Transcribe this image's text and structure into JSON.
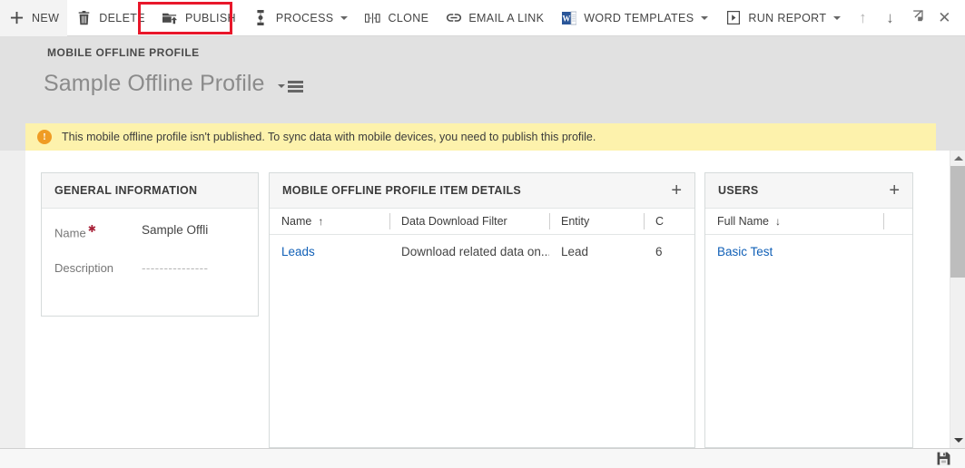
{
  "command_bar": {
    "commands": [
      {
        "id": "new",
        "label": "NEW",
        "icon": "plus-icon",
        "has_caret": false
      },
      {
        "id": "delete",
        "label": "DELETE",
        "icon": "trash-icon",
        "has_caret": false
      },
      {
        "id": "publish",
        "label": "PUBLISH",
        "icon": "publish-icon",
        "has_caret": false,
        "highlighted": true
      },
      {
        "id": "process",
        "label": "PROCESS",
        "icon": "process-icon",
        "has_caret": true
      },
      {
        "id": "clone",
        "label": "CLONE",
        "icon": "clone-icon",
        "has_caret": false
      },
      {
        "id": "email-a-link",
        "label": "EMAIL A LINK",
        "icon": "link-icon",
        "has_caret": false
      },
      {
        "id": "word-templates",
        "label": "WORD TEMPLATES",
        "icon": "word-document-icon",
        "has_caret": true
      },
      {
        "id": "run-report",
        "label": "RUN REPORT",
        "icon": "report-icon",
        "has_caret": true
      }
    ],
    "right_buttons": [
      {
        "id": "previous-record",
        "icon": "arrow-up-icon",
        "glyph": "↑",
        "dim": true
      },
      {
        "id": "next-record",
        "icon": "arrow-down-icon",
        "glyph": "↓",
        "dim": false
      },
      {
        "id": "pop-out",
        "icon": "pop-out-icon",
        "glyph": "",
        "dim": false
      },
      {
        "id": "close",
        "icon": "close-icon",
        "glyph": "✕",
        "dim": false
      }
    ],
    "highlight_color": "#e8172a"
  },
  "header": {
    "breadcrumb": "MOBILE OFFLINE PROFILE",
    "record_title": "Sample Offline Profile",
    "form_selector_icon": "form-selector-icon"
  },
  "notification": {
    "icon": "warning-icon",
    "glyph": "!",
    "message": "This mobile offline profile isn't published. To sync data with mobile devices, you need to publish this profile.",
    "background": "#fdf2ac",
    "icon_color": "#ef9c24"
  },
  "general_information": {
    "title": "GENERAL INFORMATION",
    "fields": [
      {
        "label": "Name",
        "value": "Sample Offli",
        "required": true,
        "empty": false
      },
      {
        "label": "Description",
        "value": "---------------",
        "required": false,
        "empty": true
      }
    ]
  },
  "profile_item_details": {
    "title": "MOBILE OFFLINE PROFILE ITEM DETAILS",
    "add_icon": "plus-icon",
    "add_label": "+",
    "columns": [
      {
        "label": "Name",
        "sort": "↑"
      },
      {
        "label": "Data Download Filter",
        "sort": ""
      },
      {
        "label": "Entity",
        "sort": ""
      },
      {
        "label": "C",
        "sort": ""
      }
    ],
    "rows": [
      {
        "name": "Leads",
        "filter": "Download related data on...",
        "entity": "Lead",
        "clipped": "6"
      }
    ]
  },
  "users": {
    "title": "USERS",
    "add_icon": "plus-icon",
    "add_label": "+",
    "columns": [
      {
        "label": "Full Name",
        "sort": "↓"
      },
      {
        "label": "",
        "sort": ""
      }
    ],
    "rows": [
      {
        "full_name": "Basic Test"
      }
    ]
  },
  "scrollbar": {
    "up_icon": "scroll-up-arrow-icon",
    "down_icon": "scroll-down-arrow-icon",
    "thumb_icon": "scroll-thumb"
  },
  "status_bar": {
    "save_icon": "save-icon",
    "save_label": "Save"
  }
}
